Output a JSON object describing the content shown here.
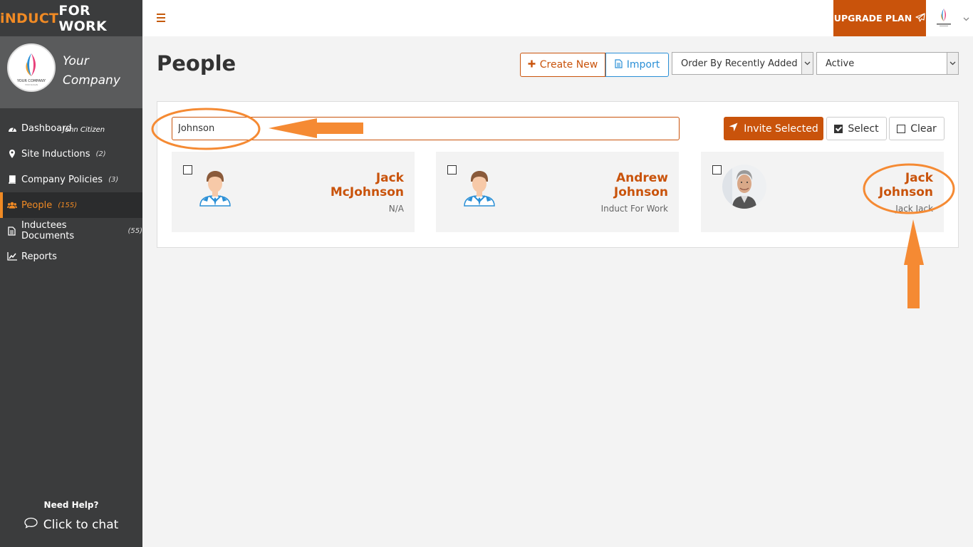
{
  "brand": {
    "part1": "iNDUCT",
    "part2": "FOR WORK"
  },
  "profile": {
    "company": "Your Company",
    "user": "John Citizen",
    "logo_text": "YOUR COMPANY"
  },
  "sidebar": {
    "items": [
      {
        "label": "Dashboard",
        "count": ""
      },
      {
        "label": "Site Inductions",
        "count": "(2)"
      },
      {
        "label": "Company Policies",
        "count": "(3)"
      },
      {
        "label": "People",
        "count": "(155)"
      },
      {
        "label": "Inductees Documents",
        "count": "(55)"
      },
      {
        "label": "Reports",
        "count": ""
      }
    ],
    "help_title": "Need Help?",
    "chat_label": "Click to chat"
  },
  "topbar": {
    "upgrade_label": "UPGRADE PLAN"
  },
  "page": {
    "title": "People",
    "create_label": "Create New",
    "import_label": "Import",
    "order_select": "Order By Recently Added",
    "status_select": "Active"
  },
  "search": {
    "value": "Johnson"
  },
  "actions": {
    "invite_label": "Invite Selected",
    "select_label": "Select",
    "clear_label": "Clear"
  },
  "people": [
    {
      "first": "Jack",
      "last": "McJohnson",
      "sub": "N/A"
    },
    {
      "first": "Andrew",
      "last": "Johnson",
      "sub": "Induct For Work"
    },
    {
      "first": "Jack",
      "last": "Johnson",
      "sub": "Jack Jack"
    }
  ],
  "colors": {
    "accent": "#c9530b",
    "sidebar": "#3b3c3d",
    "annotation": "#f58a33",
    "link": "#2a8fd6"
  }
}
